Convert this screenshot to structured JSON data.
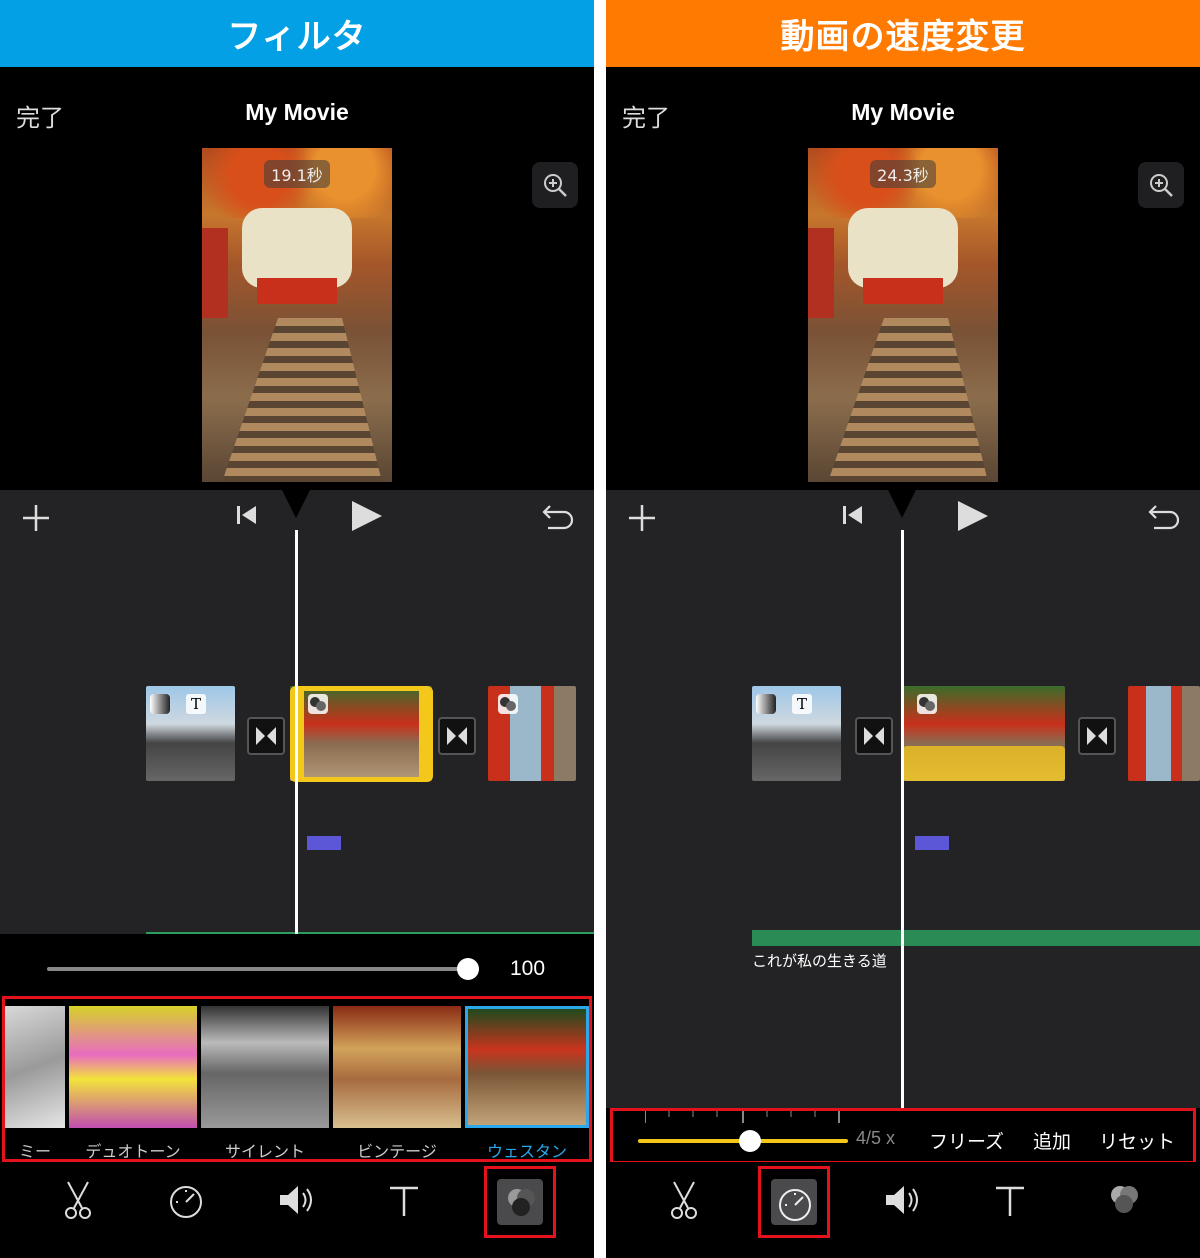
{
  "colors": {
    "banner_left": "#03a0e6",
    "banner_right": "#ff7a00",
    "highlight_red": "#e3121b",
    "selection_yellow": "#f4c81b",
    "selected_filter_blue": "#2ba7ea",
    "audio_purple": "#5b57d6",
    "title_green": "#2a8c54"
  },
  "left": {
    "banner": "フィルタ",
    "nav": {
      "done": "完了",
      "title": "My Movie"
    },
    "preview_duration": "19.1秒",
    "intensity_value": "100",
    "filters": [
      {
        "label": "ミー",
        "selected": false
      },
      {
        "label": "デュオトーン",
        "selected": false
      },
      {
        "label": "サイレント",
        "selected": false
      },
      {
        "label": "ビンテージ",
        "selected": false
      },
      {
        "label": "ウェスタン",
        "selected": true
      }
    ],
    "toolbar": [
      "scissors-icon",
      "speedometer-icon",
      "volume-icon",
      "text-icon",
      "filter-icon"
    ],
    "active_tool": "filter-icon"
  },
  "right": {
    "banner": "動画の速度変更",
    "nav": {
      "done": "完了",
      "title": "My Movie"
    },
    "preview_duration": "24.3秒",
    "title_caption": "これが私の生きる道",
    "speed": {
      "value_label": "4/5 x",
      "freeze": "フリーズ",
      "add": "追加",
      "reset": "リセット"
    },
    "toolbar": [
      "scissors-icon",
      "speedometer-icon",
      "volume-icon",
      "text-icon",
      "filter-icon"
    ],
    "active_tool": "speedometer-icon"
  }
}
